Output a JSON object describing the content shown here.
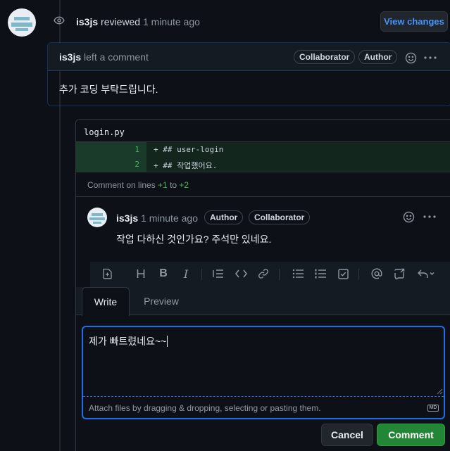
{
  "review_header": {
    "user": "is3js",
    "action": "reviewed",
    "time": "1 minute ago",
    "view_changes_label": "View changes"
  },
  "comment": {
    "user": "is3js",
    "action": "left a comment",
    "badges": [
      "Collaborator",
      "Author"
    ],
    "body": "추가 코딩 부탁드립니다."
  },
  "file": {
    "name": "login.py",
    "lines": [
      {
        "num": "1",
        "code": "+ ## user-login"
      },
      {
        "num": "2",
        "code": "+ ## 작업했어요."
      }
    ],
    "range_prefix": "Comment on lines ",
    "range_start": "+1",
    "range_mid": " to ",
    "range_end": "+2"
  },
  "reply": {
    "user": "is3js",
    "time": "1 minute ago",
    "badges": [
      "Author",
      "Collaborator"
    ],
    "body": "작업 다하신 것인가요? 주석만 있네요."
  },
  "editor": {
    "tabs": [
      "Write",
      "Preview"
    ],
    "active_tab": "Write",
    "text": "제가 빠트렸네요~~",
    "attach_hint": "Attach files by dragging & dropping, selecting or pasting them.",
    "markdown_badge": "MD",
    "cancel_label": "Cancel",
    "comment_label": "Comment"
  },
  "colors": {
    "accent": "#4493f8",
    "added_bg": "#12261e",
    "added_text": "#3fb950",
    "primary_btn": "#238636"
  }
}
